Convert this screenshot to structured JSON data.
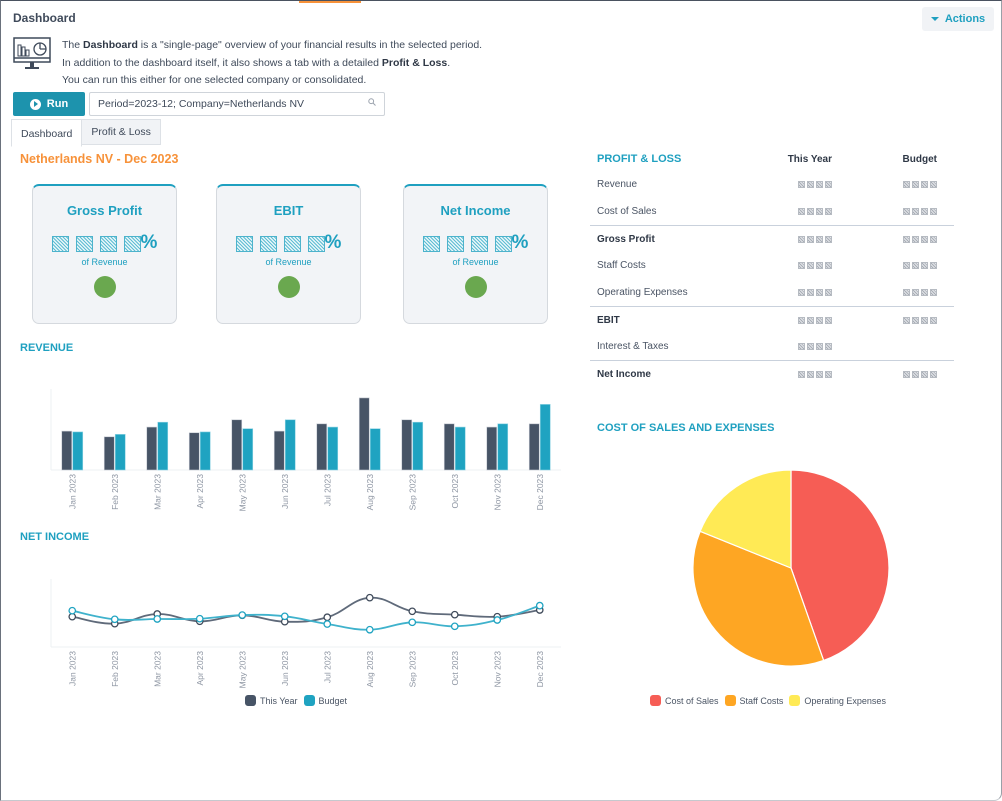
{
  "header": {
    "title": "Dashboard",
    "actions_label": "Actions",
    "intro_line1_pre": "The ",
    "intro_line1_bold": "Dashboard",
    "intro_line1_post": " is a \"single-page\" overview of your financial results in the selected period.",
    "intro_line2_pre": "In addition to the dashboard itself, it also shows a tab with a detailed ",
    "intro_line2_bold": "Profit & Loss",
    "intro_line2_post": ".",
    "intro_line3": "You can run this either for one selected company or consolidated.",
    "run_label": "Run",
    "param_value": "Period=2023-12; Company=Netherlands NV"
  },
  "tabs": [
    {
      "label": "Dashboard",
      "active": true
    },
    {
      "label": "Profit & Loss",
      "active": false
    }
  ],
  "company_title": "Netherlands NV - Dec 2023",
  "kpis": [
    {
      "title": "Gross Profit",
      "value_masked": true,
      "suffix": "%",
      "sub": "of Revenue",
      "status_color": "#6aa84f"
    },
    {
      "title": "EBIT",
      "value_masked": true,
      "suffix": "%",
      "sub": "of Revenue",
      "status_color": "#6aa84f"
    },
    {
      "title": "Net Income",
      "value_masked": true,
      "suffix": "%",
      "sub": "of Revenue",
      "status_color": "#6aa84f"
    }
  ],
  "pl": {
    "title": "PROFIT & LOSS",
    "col_this_year": "This Year",
    "col_budget": "Budget",
    "rows": [
      {
        "label": "Revenue",
        "bold": false,
        "has_budget": true
      },
      {
        "label": "Cost of Sales",
        "bold": false,
        "has_budget": true
      },
      {
        "label": "Gross Profit",
        "bold": true,
        "has_budget": true
      },
      {
        "label": "Staff Costs",
        "bold": false,
        "has_budget": true
      },
      {
        "label": "Operating Expenses",
        "bold": false,
        "has_budget": true
      },
      {
        "label": "EBIT",
        "bold": true,
        "has_budget": true
      },
      {
        "label": "Interest & Taxes",
        "bold": false,
        "has_budget": false
      },
      {
        "label": "Net Income",
        "bold": true,
        "has_budget": true
      }
    ]
  },
  "colors": {
    "this_year": "#475466",
    "budget": "#1fa3c1",
    "accent": "#1fa0c0",
    "orange": "#f7923a"
  },
  "chart_data": [
    {
      "type": "bar",
      "title": "REVENUE",
      "categories": [
        "Jan 2023",
        "Feb 2023",
        "Mar 2023",
        "Apr 2023",
        "May 2023",
        "Jun 2023",
        "Jul 2023",
        "Aug 2023",
        "Sep 2023",
        "Oct 2023",
        "Nov 2023",
        "Dec 2023"
      ],
      "series": [
        {
          "name": "This Year",
          "values": [
            48,
            41,
            53,
            46,
            62,
            48,
            57,
            89,
            62,
            57,
            53,
            57
          ]
        },
        {
          "name": "Budget",
          "values": [
            47,
            44,
            59,
            47,
            51,
            62,
            53,
            51,
            59,
            53,
            57,
            81
          ]
        }
      ],
      "ylim": [
        0,
        100
      ],
      "y_ticks_shown": false,
      "grid": false,
      "legend": "none"
    },
    {
      "type": "line",
      "title": "NET INCOME",
      "categories": [
        "Jan 2023",
        "Feb 2023",
        "Mar 2023",
        "Apr 2023",
        "May 2023",
        "Jun 2023",
        "Jul 2023",
        "Aug 2023",
        "Sep 2023",
        "Oct 2023",
        "Nov 2023",
        "Dec 2023"
      ],
      "series": [
        {
          "name": "This Year",
          "values": [
            44.6,
            34.3,
            48.5,
            37.8,
            46.6,
            37.2,
            43.7,
            72.5,
            52.5,
            47.5,
            44.6,
            54.4
          ]
        },
        {
          "name": "Budget",
          "values": [
            53.4,
            40.7,
            41.2,
            41.6,
            47.0,
            45.1,
            33.8,
            25.4,
            36.3,
            30.4,
            39.7,
            60.8
          ]
        }
      ],
      "ylim": [
        0,
        100
      ],
      "y_ticks_shown": false,
      "grid": false,
      "legend": "bottom-center"
    },
    {
      "type": "pie",
      "title": "COST OF SALES AND EXPENSES",
      "labels": [
        "Cost of Sales",
        "Staff Costs",
        "Operating Expenses"
      ],
      "values": [
        44.6,
        36.5,
        18.9
      ],
      "colors": [
        "#f65d55",
        "#fea623",
        "#ffea55"
      ],
      "legend": "bottom-center"
    }
  ]
}
